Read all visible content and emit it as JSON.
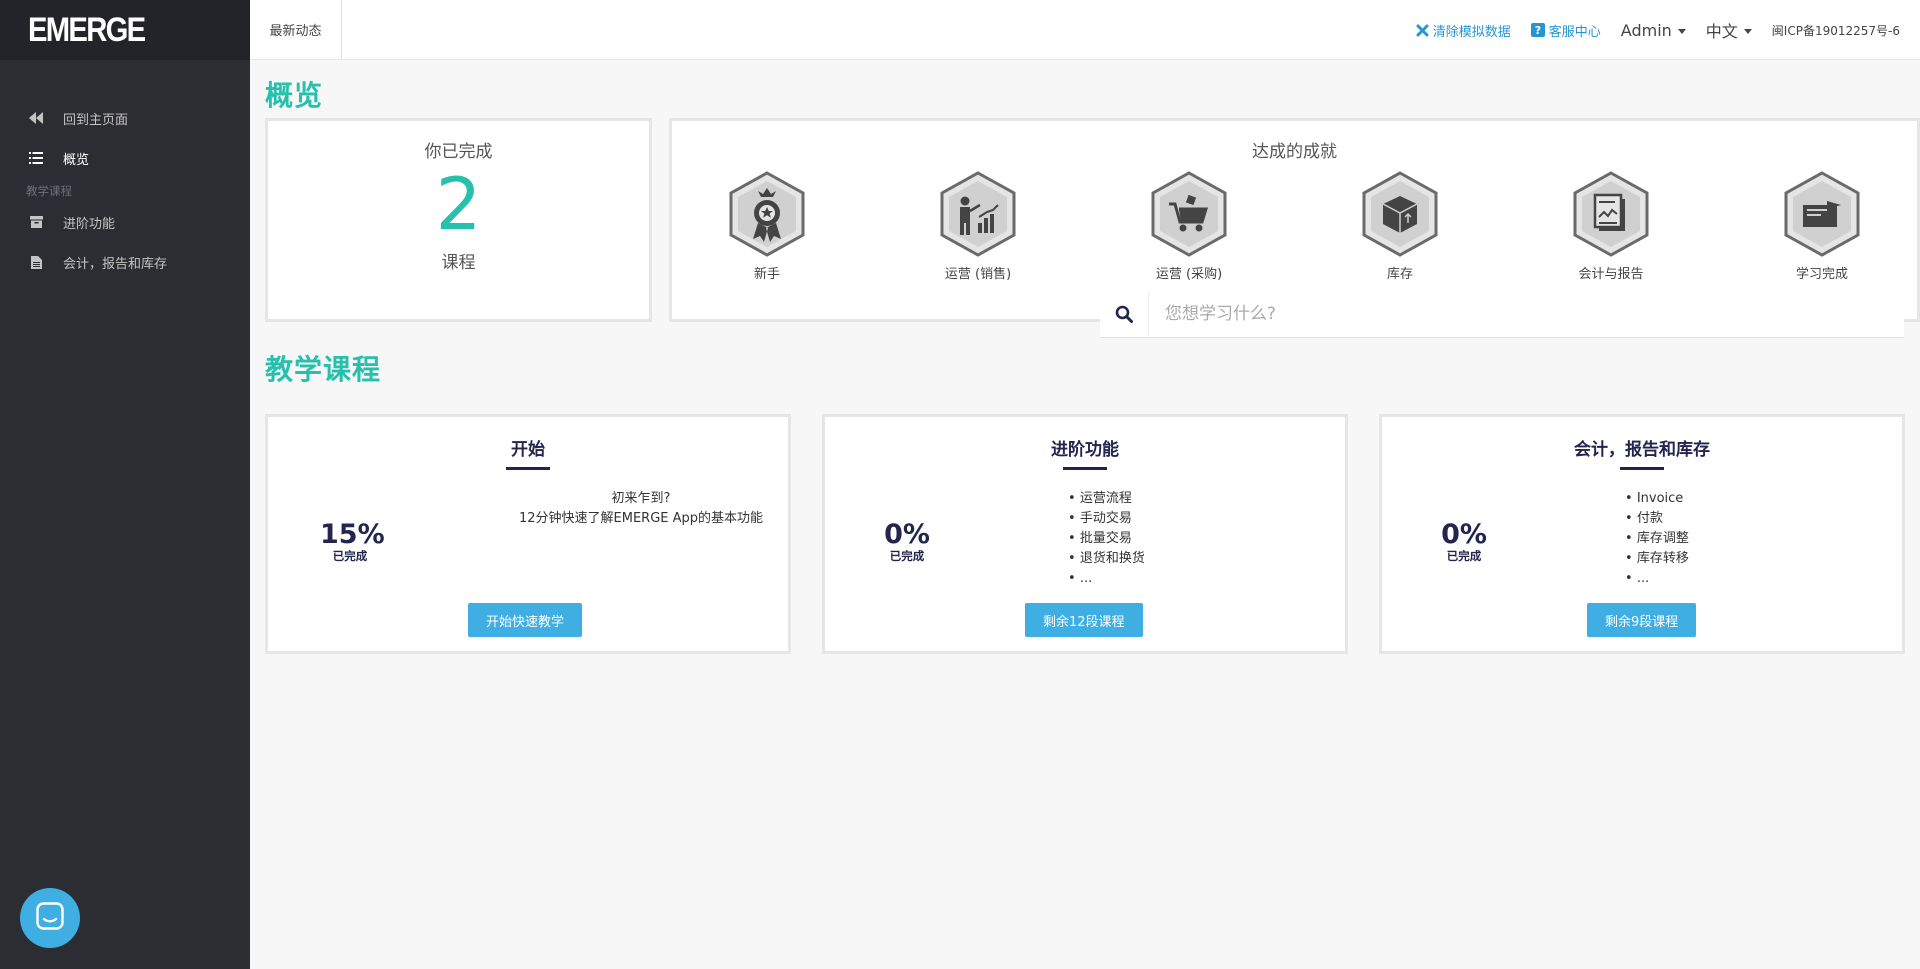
{
  "brand": {
    "logo_text": "EMERGE"
  },
  "sidebar": {
    "items": [
      {
        "label": "回到主页面",
        "icon": "backward-icon"
      },
      {
        "label": "概览",
        "icon": "list-icon"
      }
    ],
    "section_label": "教学课程",
    "course_items": [
      {
        "label": "进阶功能",
        "icon": "archive-icon"
      },
      {
        "label": "会计，报告和库存",
        "icon": "file-icon"
      }
    ]
  },
  "topbar": {
    "tab_label": "最新动态",
    "clear_label": "清除模拟数据",
    "help_label": "客服中心",
    "user_label": "Admin",
    "lang_label": "中文",
    "icp": "闽ICP备19012257号-6"
  },
  "overview": {
    "heading": "概览",
    "completed_title": "你已完成",
    "completed_count": "2",
    "completed_unit": "课程",
    "achievements_title": "达成的成就",
    "achievements": [
      {
        "label": "新手",
        "icon": "medal-icon"
      },
      {
        "label": "运营 (销售)",
        "icon": "sales-presentation-icon"
      },
      {
        "label": "运营 (采购)",
        "icon": "shopping-cart-icon"
      },
      {
        "label": "库存",
        "icon": "box-icon"
      },
      {
        "label": "会计与报告",
        "icon": "report-icon"
      },
      {
        "label": "学习完成",
        "icon": "diploma-icon"
      }
    ]
  },
  "courses": {
    "heading": "教学课程",
    "search_placeholder": "您想学习什么?",
    "cards": [
      {
        "title": "开始",
        "percent": "15%",
        "percent_label": "已完成",
        "desc_lines": [
          "初来乍到?",
          "12分钟快速了解EMERGE App的基本功能"
        ],
        "button": "开始快速教学"
      },
      {
        "title": "进阶功能",
        "percent": "0%",
        "percent_label": "已完成",
        "bullets": [
          "运营流程",
          "手动交易",
          "批量交易",
          "退货和换货",
          "..."
        ],
        "button": "剩余12段课程"
      },
      {
        "title": "会计，报告和库存",
        "percent": "0%",
        "percent_label": "已完成",
        "bullets": [
          "Invoice",
          "付款",
          "库存调整",
          "库存转移",
          "..."
        ],
        "button": "剩余9段课程"
      }
    ]
  },
  "colors": {
    "accent": "#26c0ad",
    "button": "#3faee2",
    "sidebar": "#2c2c33",
    "navy": "#22264f"
  }
}
